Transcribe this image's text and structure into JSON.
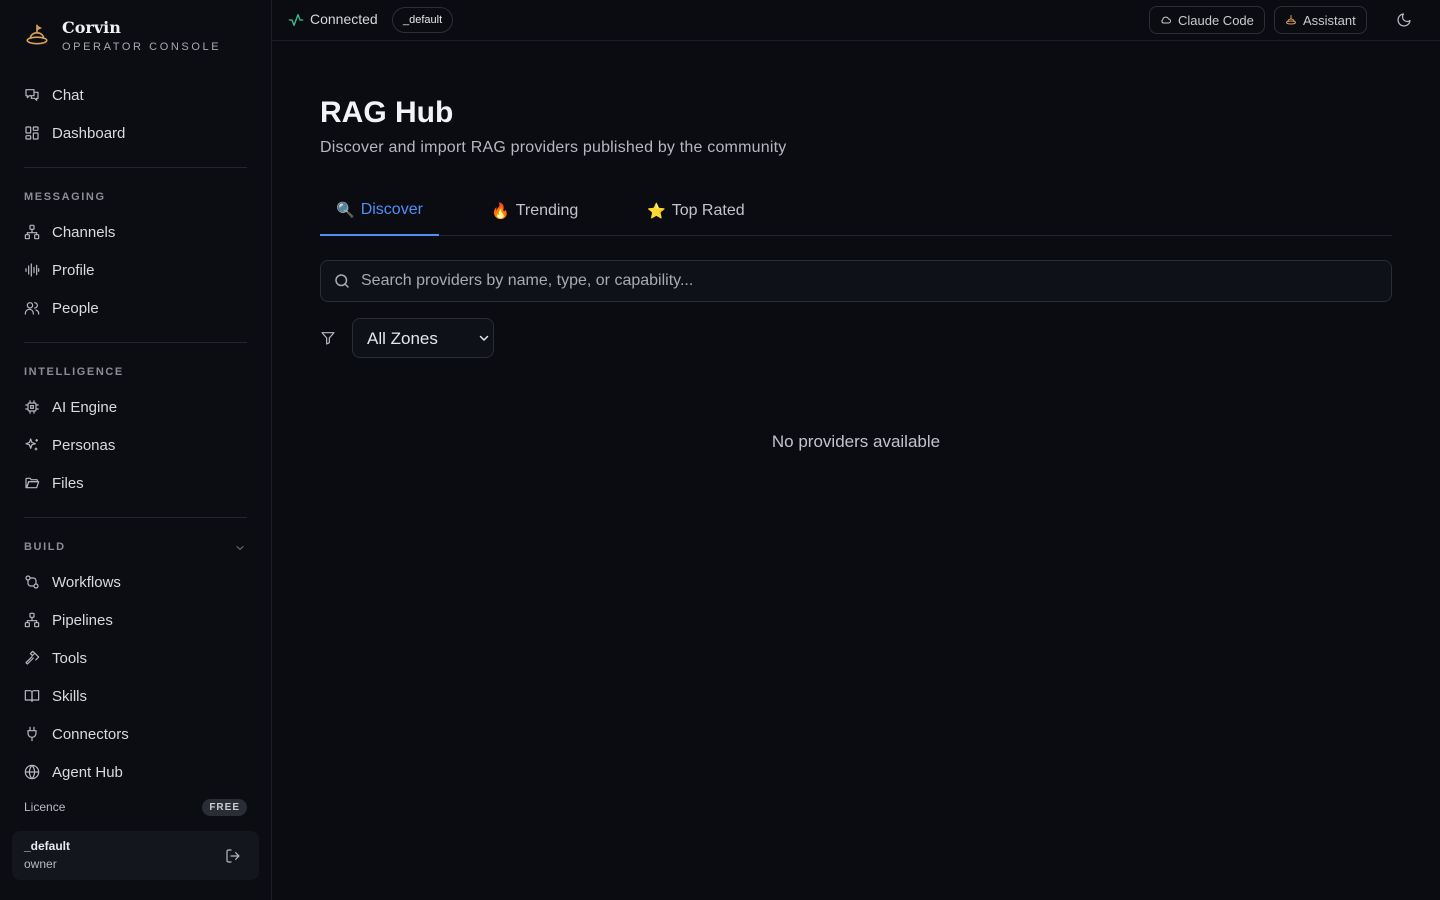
{
  "brand": {
    "name": "Corvin",
    "subtitle": "OPERATOR CONSOLE"
  },
  "sidebar": {
    "top_items": [
      {
        "label": "Chat",
        "icon": "chat-icon"
      },
      {
        "label": "Dashboard",
        "icon": "dashboard-icon"
      }
    ],
    "sections": [
      {
        "title": "MESSAGING",
        "items": [
          {
            "label": "Channels",
            "icon": "channels-icon"
          },
          {
            "label": "Profile",
            "icon": "audio-wave-icon"
          },
          {
            "label": "People",
            "icon": "people-icon"
          }
        ]
      },
      {
        "title": "INTELLIGENCE",
        "items": [
          {
            "label": "AI Engine",
            "icon": "cpu-icon"
          },
          {
            "label": "Personas",
            "icon": "sparkles-icon"
          },
          {
            "label": "Files",
            "icon": "folder-icon"
          }
        ]
      },
      {
        "title": "BUILD",
        "collapsible": true,
        "items": [
          {
            "label": "Workflows",
            "icon": "workflow-icon"
          },
          {
            "label": "Pipelines",
            "icon": "network-icon"
          },
          {
            "label": "Tools",
            "icon": "hammer-icon"
          },
          {
            "label": "Skills",
            "icon": "book-icon"
          },
          {
            "label": "Connectors",
            "icon": "plug-icon"
          },
          {
            "label": "Agent Hub",
            "icon": "globe-icon"
          }
        ]
      }
    ],
    "licence": {
      "label": "Licence",
      "badge": "FREE"
    },
    "user": {
      "name": "_default",
      "role": "owner"
    }
  },
  "topbar": {
    "status": "Connected",
    "workspace": "_default",
    "buttons": [
      {
        "label": "Claude Code",
        "icon": "cloud-icon"
      },
      {
        "label": "Assistant",
        "icon": "assistant-icon"
      }
    ],
    "theme_icon": "moon-icon"
  },
  "main": {
    "title": "RAG Hub",
    "subtitle": "Discover and import RAG providers published by the community",
    "tabs": [
      {
        "emoji": "🔍",
        "label": "Discover",
        "active": true
      },
      {
        "emoji": "🔥",
        "label": "Trending",
        "active": false
      },
      {
        "emoji": "⭐",
        "label": "Top Rated",
        "active": false
      }
    ],
    "search": {
      "placeholder": "Search providers by name, type, or capability...",
      "value": ""
    },
    "zone_filter": {
      "selected": "All Zones"
    },
    "empty_message": "No providers available"
  },
  "colors": {
    "accent": "#4f8ef7",
    "status_ok": "#3fbf88",
    "brand_icon": "#d6a15c",
    "background": "#0a0c12"
  }
}
